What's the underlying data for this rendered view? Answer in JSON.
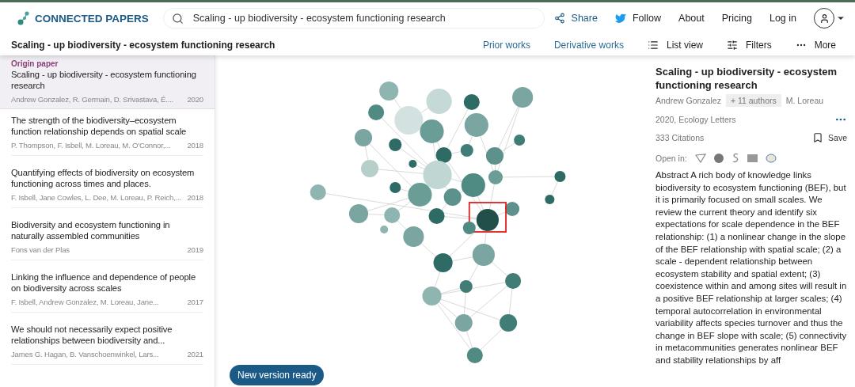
{
  "header": {
    "logo": "CONNECTED PAPERS",
    "search": {
      "value": "Scaling - up biodiversity - ecosystem functioning research"
    },
    "nav": [
      {
        "label": "Share",
        "kind": "share"
      },
      {
        "label": "Follow",
        "kind": "twitter"
      },
      {
        "label": "About",
        "kind": "plain"
      },
      {
        "label": "Pricing",
        "kind": "plain"
      },
      {
        "label": "Log in",
        "kind": "plain"
      }
    ]
  },
  "subbar": {
    "title": "Scaling - up biodiversity - ecosystem functioning research",
    "links": [
      {
        "label": "Prior works",
        "kind": "link"
      },
      {
        "label": "Derivative works",
        "kind": "link"
      },
      {
        "label": "List view",
        "kind": "list"
      },
      {
        "label": "Filters",
        "kind": "filters"
      },
      {
        "label": "More",
        "kind": "more"
      }
    ]
  },
  "papers": [
    {
      "tag": "Origin paper",
      "title": "Scaling - up biodiversity - ecosystem functioning research",
      "authors": "Andrew Gonzalez, R. Germain, D. Srivastava, É....",
      "year": "2020",
      "selected": true
    },
    {
      "title": "The strength of the biodiversity–ecosystem function relationship depends on spatial scale",
      "authors": "P. Thompson, F. Isbell, M. Loreau, M. O'Connor,...",
      "year": "2018",
      "selected": false
    },
    {
      "title": "Quantifying effects of biodiversity on ecosystem functioning across times and places.",
      "authors": "F. Isbell, Jane Cowles, L. Dee, M. Loreau, P. Reich,...",
      "year": "2018",
      "selected": false
    },
    {
      "title": "Biodiversity and ecosystem functioning in naturally assembled communities",
      "authors": "Fons van der Plas",
      "year": "2019",
      "selected": false
    },
    {
      "title": "Linking the influence and dependence of people on biodiversity across scales",
      "authors": "F. Isbell, Andrew Gonzalez, M. Loreau, Jane...",
      "year": "2017",
      "selected": false
    },
    {
      "title": "We should not necessarily expect positive relationships between biodiversity and...",
      "authors": "James G. Hagan, B. Vanschoenwinkel, Lars...",
      "year": "2021",
      "selected": false
    }
  ],
  "graph": {
    "nodes": [
      {
        "color": "#8fb5b0"
      },
      {
        "color": "#c5d9d6"
      },
      {
        "color": "#2e6b64"
      },
      {
        "color": "#7aa5a0"
      },
      {
        "color": "#4f8a83"
      },
      {
        "color": "#d3e2e0"
      },
      {
        "color": "#6b9d97"
      },
      {
        "color": "#7aa5a0"
      },
      {
        "color": "#7aa5a0"
      },
      {
        "color": "#2e6b64"
      },
      {
        "color": "#3f7d76"
      },
      {
        "color": "#3f7d76"
      },
      {
        "color": "#2e6b64"
      },
      {
        "color": "#5d918b"
      },
      {
        "color": "#2e6b64"
      },
      {
        "color": "#b7cfcb"
      },
      {
        "color": "#c0d6d2"
      },
      {
        "color": "#6b9d97"
      },
      {
        "color": "#2e6b64"
      },
      {
        "color": "#2e6b64"
      },
      {
        "color": "#4f8a83"
      },
      {
        "color": "#6b9d97"
      },
      {
        "color": "#5d918b"
      },
      {
        "color": "#2e6b64"
      },
      {
        "color": "#8fb5b0"
      },
      {
        "color": "#5d918b"
      },
      {
        "color": "#7aa5a0"
      },
      {
        "color": "#8fb5b0"
      },
      {
        "color": "#2e6b64"
      },
      {
        "color": "#234f4a",
        "selected": true
      },
      {
        "color": "#4f8a83"
      },
      {
        "color": "#8fb5b0"
      },
      {
        "color": "#7aa5a0"
      },
      {
        "color": "#2e6b64"
      },
      {
        "color": "#7aa5a0"
      },
      {
        "color": "#3f7d76"
      },
      {
        "color": "#3f7d76"
      },
      {
        "color": "#8fb5b0"
      },
      {
        "color": "#7aa5a0"
      },
      {
        "color": "#3f7d76"
      },
      {
        "color": "#4f8a83"
      }
    ],
    "notice": "New version ready"
  },
  "detail": {
    "title": "Scaling - up biodiversity - ecosystem functioning research",
    "first_author": "Andrew Gonzalez",
    "more_authors": "+ 11 authors",
    "last_author": "M. Loreau",
    "venue": "2020, Ecology Letters",
    "citations": "333 Citations",
    "save": "Save",
    "open_in": "Open in:",
    "abstract": "Abstract A rich body of knowledge links biodiversity to ecosystem functioning (BEF), but it is primarily focused on small scales. We review the current theory and identify six expectations for scale dependence in the BEF relationship: (1) a nonlinear change in the slope of the BEF relationship with spatial scale; (2) a scale - dependent relationship between ecosystem stability and spatial extent; (3) coexistence within and among sites will result in a positive BEF relationship at larger scales; (4) temporal autocorrelation in environmental variability affects species turnover and thus the change in BEF slope with scale; (5) connectivity in metacommunities generates nonlinear BEF and stability relationships by aff"
  }
}
